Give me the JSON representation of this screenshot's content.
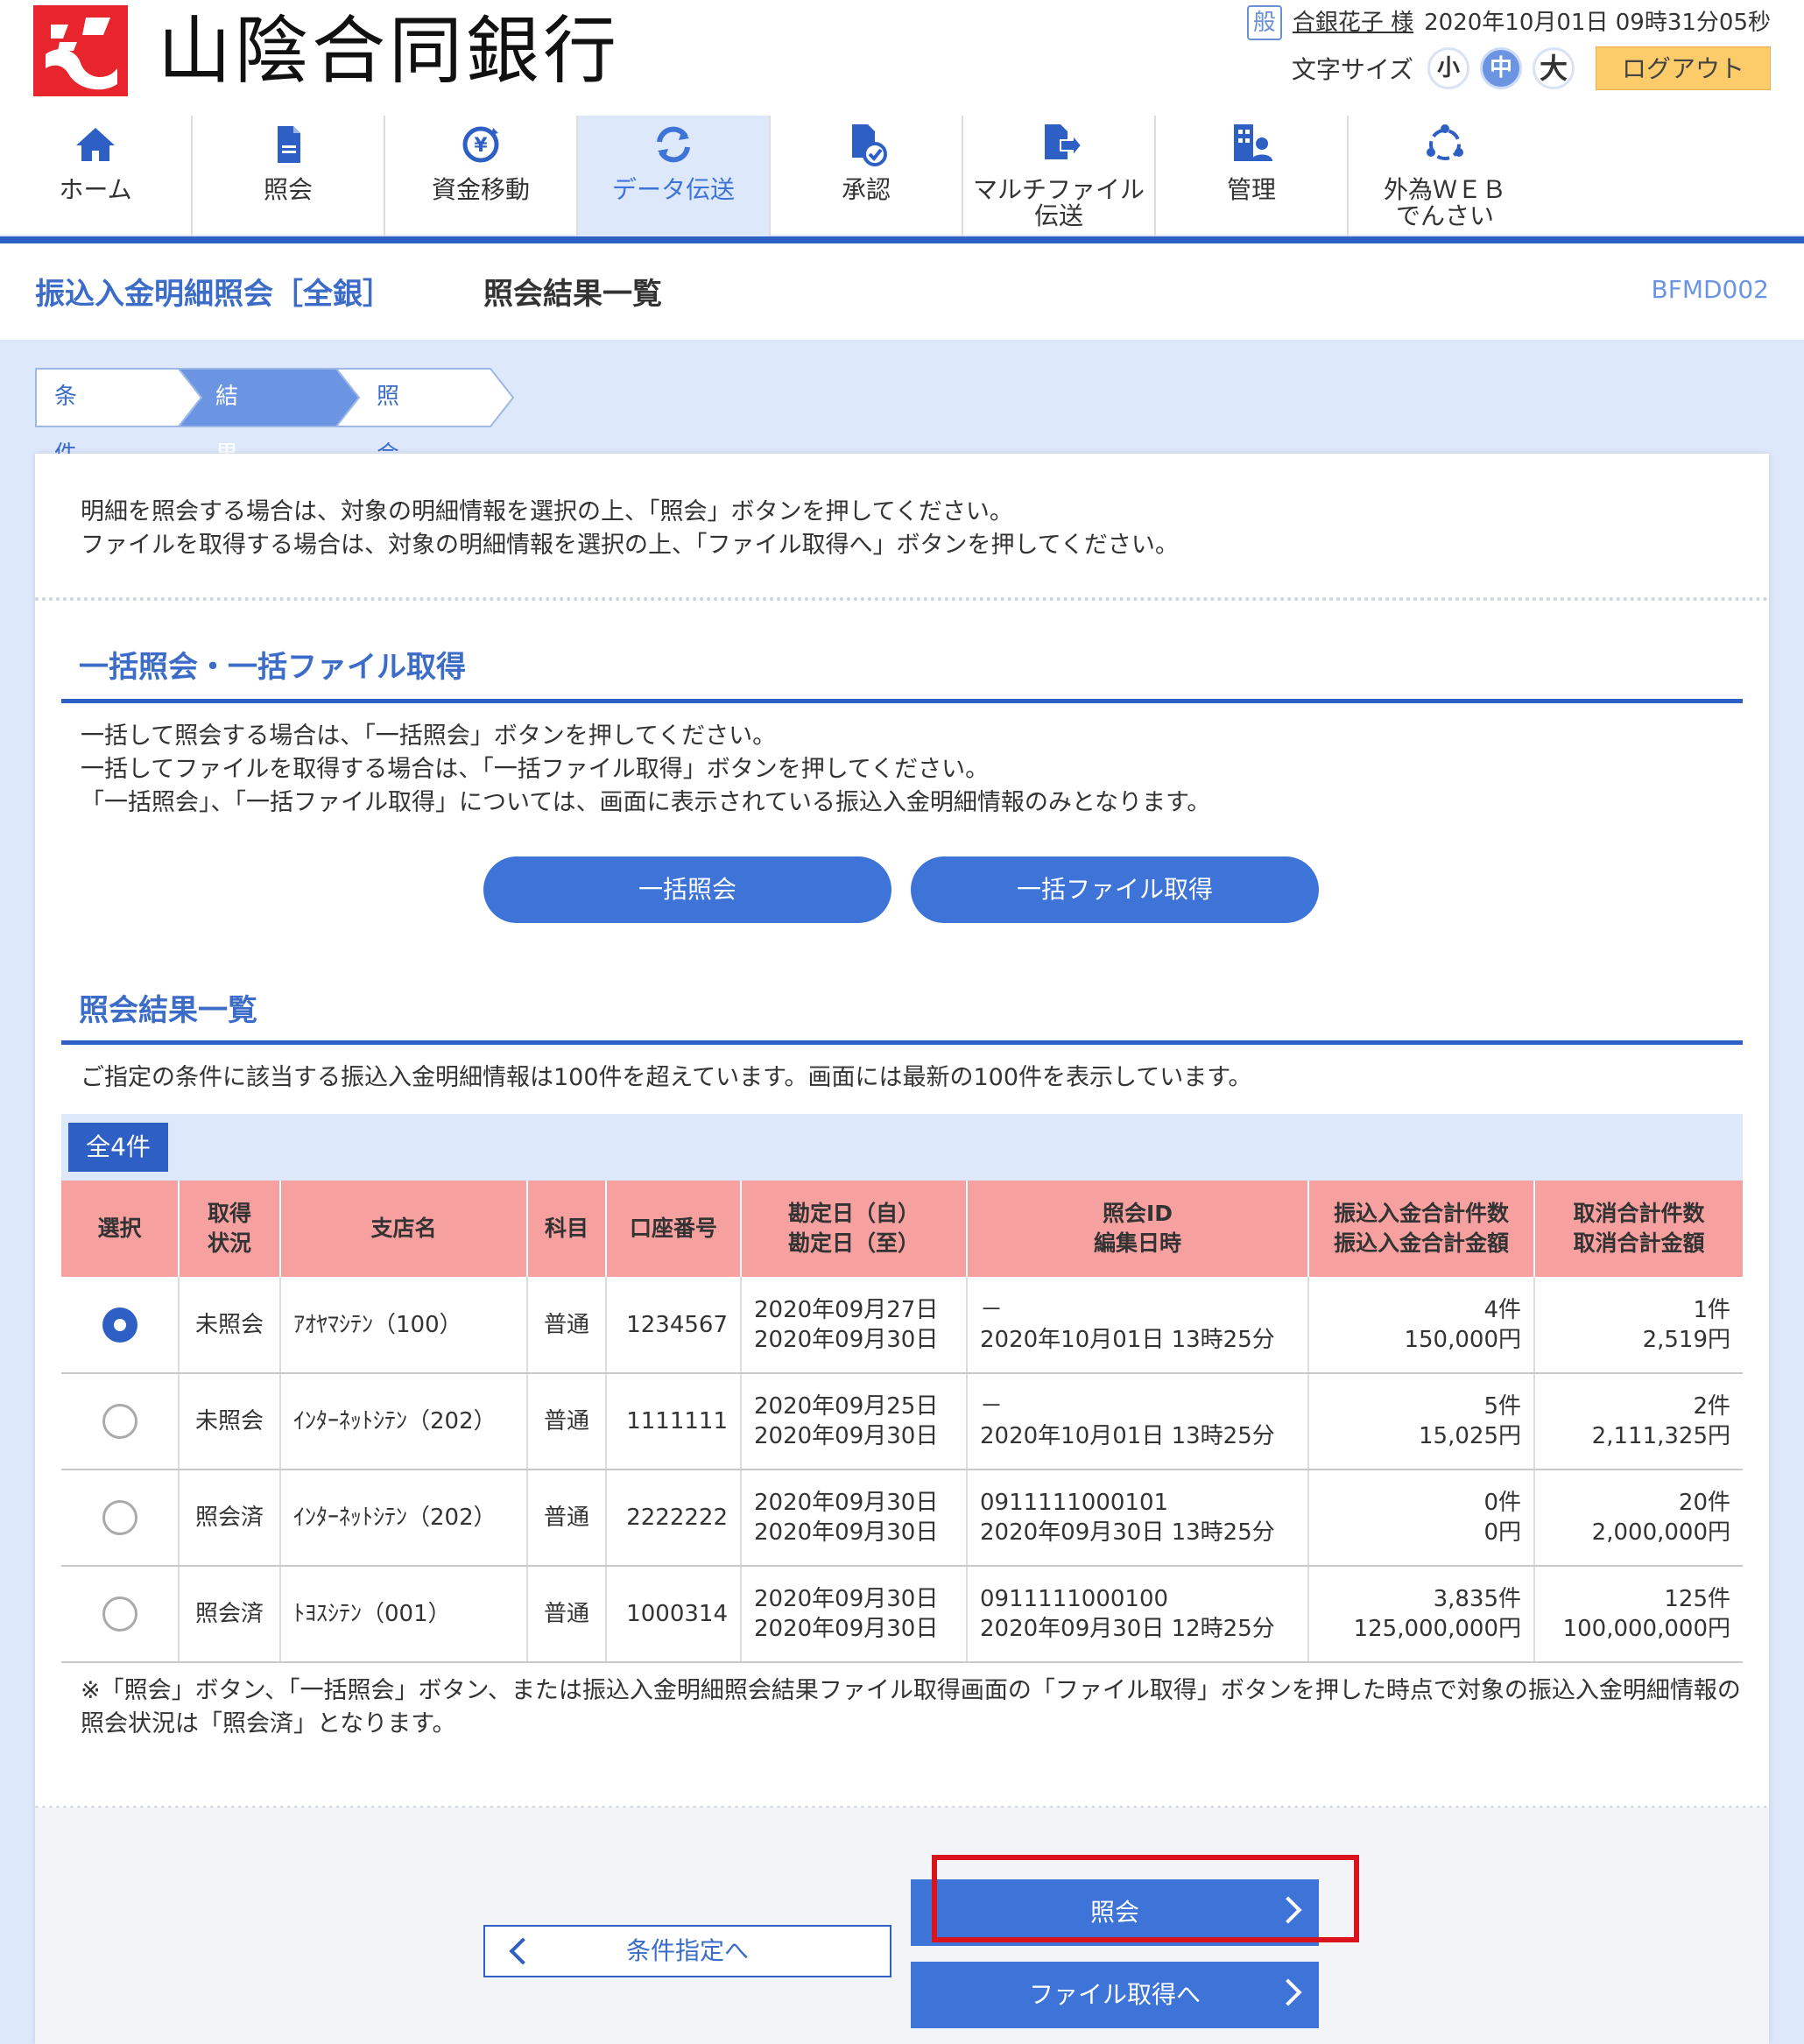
{
  "header": {
    "bank_name": "山陰合同銀行",
    "user_badge": "般",
    "user_name": "合銀花子 様",
    "datetime": "2020年10月01日 09時31分05秒",
    "font_size_label": "文字サイズ",
    "font_sizes": [
      "小",
      "中",
      "大"
    ],
    "font_size_selected": "中",
    "logout_label": "ログアウト"
  },
  "nav": {
    "items": [
      {
        "label": "ホーム",
        "icon": "home-icon"
      },
      {
        "label": "照会",
        "icon": "document-icon"
      },
      {
        "label": "資金移動",
        "icon": "yen-transfer-icon"
      },
      {
        "label": "データ伝送",
        "icon": "refresh-icon"
      },
      {
        "label": "承認",
        "icon": "approve-icon"
      },
      {
        "label": "マルチファイル\n伝送",
        "icon": "multi-file-icon"
      },
      {
        "label": "管理",
        "icon": "admin-icon"
      },
      {
        "label": "外為ＷＥＢ\nでんさい",
        "icon": "forex-icon"
      }
    ],
    "active": "データ伝送"
  },
  "page": {
    "title": "振込入金明細照会［全銀］",
    "subtitle": "照会結果一覧",
    "screen_id": "BFMD002"
  },
  "steps": [
    "条件指定",
    "結果一覧",
    "照会結果"
  ],
  "intro": {
    "line1": "明細を照会する場合は、対象の明細情報を選択の上、「照会」ボタンを押してください。",
    "line2": "ファイルを取得する場合は、対象の明細情報を選択の上、「ファイル取得へ」ボタンを押してください。"
  },
  "bulk": {
    "title": "一括照会・一括ファイル取得",
    "line1": "一括して照会する場合は、「一括照会」ボタンを押してください。",
    "line2": "一括してファイルを取得する場合は、「一括ファイル取得」ボタンを押してください。",
    "line3": "「一括照会」、「一括ファイル取得」については、画面に表示されている振込入金明細情報のみとなります。",
    "bulk_inquiry_label": "一括照会",
    "bulk_file_label": "一括ファイル取得"
  },
  "results": {
    "title": "照会結果一覧",
    "notice": "ご指定の条件に該当する振込入金明細情報は100件を超えています。画面には最新の100件を表示しています。",
    "count_label": "全4件",
    "columns": [
      "選択",
      "取得\n状況",
      "支店名",
      "科目",
      "口座番号",
      "勘定日（自）\n勘定日（至）",
      "照会ID\n編集日時",
      "振込入金合計件数\n振込入金合計金額",
      "取消合計件数\n取消合計金額"
    ],
    "rows": [
      {
        "selected": true,
        "status": "未照会",
        "branch": "ｱｵﾔﾏｼﾃﾝ（100）",
        "subject": "普通",
        "account": "1234567",
        "date_from": "2020年09月27日",
        "date_to": "2020年09月30日",
        "inquiry_id": "－",
        "edited": "2020年10月01日 13時25分",
        "count": "4件",
        "amount": "150,000円",
        "cancel_count": "1件",
        "cancel_amount": "2,519円"
      },
      {
        "selected": false,
        "status": "未照会",
        "branch": "ｲﾝﾀｰﾈｯﾄｼﾃﾝ（202）",
        "subject": "普通",
        "account": "1111111",
        "date_from": "2020年09月25日",
        "date_to": "2020年09月30日",
        "inquiry_id": "－",
        "edited": "2020年10月01日 13時25分",
        "count": "5件",
        "amount": "15,025円",
        "cancel_count": "2件",
        "cancel_amount": "2,111,325円"
      },
      {
        "selected": false,
        "status": "照会済",
        "branch": "ｲﾝﾀｰﾈｯﾄｼﾃﾝ（202）",
        "subject": "普通",
        "account": "2222222",
        "date_from": "2020年09月30日",
        "date_to": "2020年09月30日",
        "inquiry_id": "0911111000101",
        "edited": "2020年09月30日 13時25分",
        "count": "0件",
        "amount": "0円",
        "cancel_count": "20件",
        "cancel_amount": "2,000,000円"
      },
      {
        "selected": false,
        "status": "照会済",
        "branch": "ﾄﾖｽｼﾃﾝ（001）",
        "subject": "普通",
        "account": "1000314",
        "date_from": "2020年09月30日",
        "date_to": "2020年09月30日",
        "inquiry_id": "0911111000100",
        "edited": "2020年09月30日 12時25分",
        "count": "3,835件",
        "amount": "125,000,000円",
        "cancel_count": "125件",
        "cancel_amount": "100,000,000円"
      }
    ],
    "footnote": "※「照会」ボタン、「一括照会」ボタン、または振込入金明細照会結果ファイル取得画面の「ファイル取得」ボタンを押した時点で対象の振込入金明細情報の照会状況は「照会済」となります。"
  },
  "actions": {
    "back_label": "条件指定へ",
    "inquiry_label": "照会",
    "file_label": "ファイル取得へ"
  },
  "colors": {
    "brand_red": "#e8242c",
    "primary_blue": "#3e74d8",
    "nav_rule": "#2d5fc4",
    "table_header": "#f6a0a0",
    "logout": "#fccb6a",
    "highlight": "#d9141c"
  }
}
